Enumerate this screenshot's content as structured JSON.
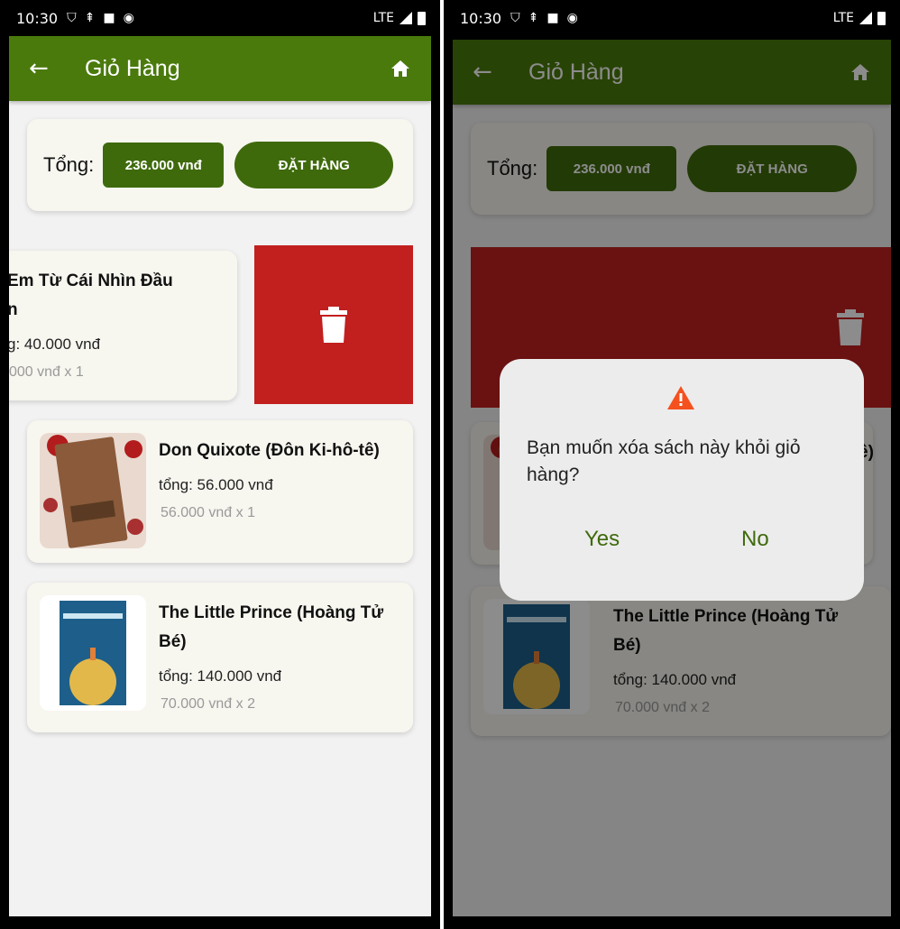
{
  "status": {
    "time": "10:30",
    "network": "LTE"
  },
  "appbar": {
    "title": "Giỏ Hàng"
  },
  "cart": {
    "total_label": "Tổng:",
    "total_value": "236.000 vnđ",
    "order_button": "ĐẶT HÀNG",
    "items": [
      {
        "title_line1": "Em Từ Cái Nhìn Đầu",
        "title_line2": "n",
        "total": "g: 40.000 vnđ",
        "unit": "000 vnđ x 1"
      },
      {
        "title": "Don Quixote (Đôn Ki-hô-tê)",
        "total": "tổng: 56.000 vnđ",
        "unit": "56.000 vnđ x 1"
      },
      {
        "title_line1": "The Little Prince (Hoàng Tử",
        "title_line2": "Bé)",
        "total": "tổng: 140.000 vnđ",
        "unit": "70.000 vnđ x 2"
      }
    ]
  },
  "dialog": {
    "message": "Bạn muốn xóa sách này khỏi giỏ hàng?",
    "partial_visible": "ê)",
    "yes": "Yes",
    "no": "No"
  },
  "colors": {
    "primary": "#4a7a0c",
    "delete": "#c21f1f",
    "warning": "#f4511e"
  },
  "icons": [
    "back-arrow-icon",
    "home-icon",
    "trash-icon",
    "warning-icon"
  ]
}
